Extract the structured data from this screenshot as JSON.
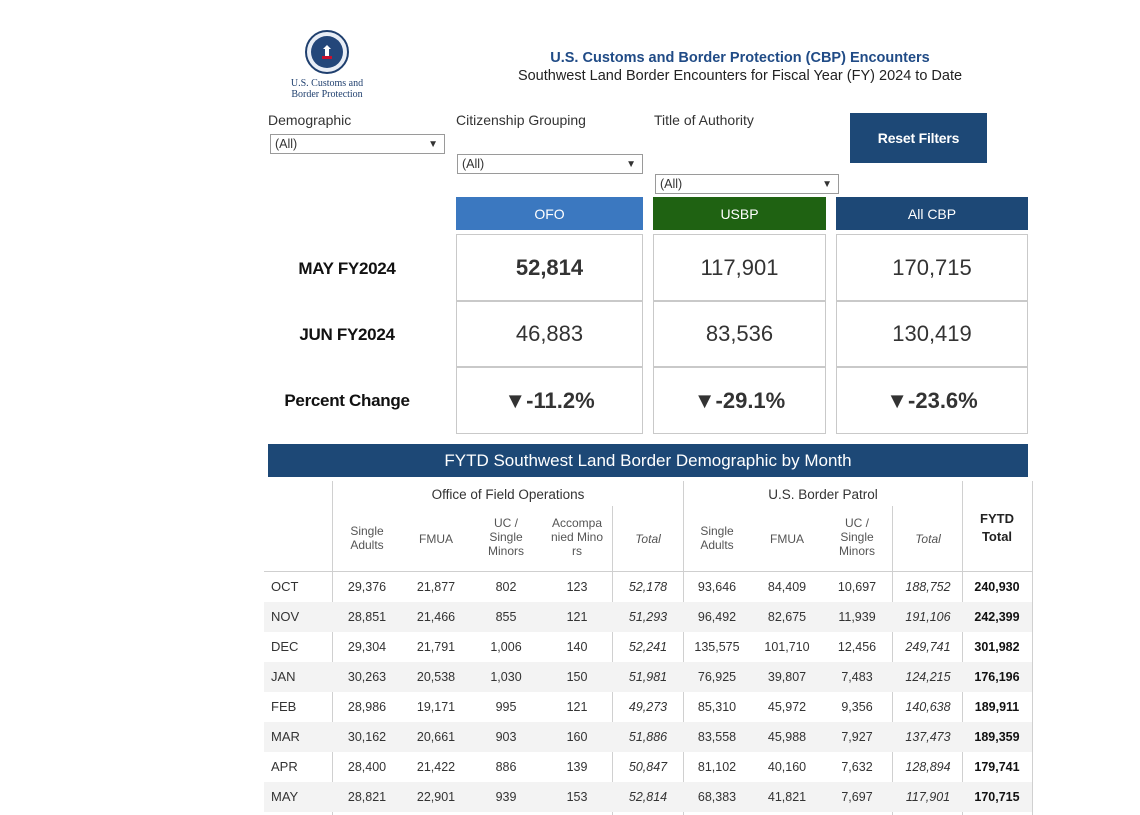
{
  "header": {
    "org_name": "U.S. Customs and Border Protection",
    "title": "U.S. Customs and Border Protection (CBP) Encounters",
    "subtitle": "Southwest Land Border Encounters for Fiscal Year (FY) 2024 to Date"
  },
  "filters": {
    "demographic": {
      "label": "Demographic",
      "value": "(All)"
    },
    "citizenship": {
      "label": "Citizenship Grouping",
      "value": "(All)"
    },
    "authority": {
      "label": "Title of Authority",
      "value": "(All)"
    },
    "reset_label": "Reset Filters"
  },
  "summary": {
    "columns": [
      {
        "label": "OFO",
        "color": "#3b78c0"
      },
      {
        "label": "USBP",
        "color": "#1f6212"
      },
      {
        "label": "All CBP",
        "color": "#1d4876"
      }
    ],
    "rows": [
      {
        "label": "MAY FY2024",
        "values": [
          "52,814",
          "117,901",
          "170,715"
        ]
      },
      {
        "label": "JUN FY2024",
        "values": [
          "46,883",
          "83,536",
          "130,419"
        ]
      },
      {
        "label": "Percent Change",
        "values": [
          "▼-11.2%",
          "▼-29.1%",
          "▼-23.6%"
        ]
      }
    ]
  },
  "table": {
    "banner": "FYTD Southwest Land Border Demographic by Month",
    "ofo_group": "Office of Field Operations",
    "usbp_group": "U.S. Border Patrol",
    "fytd_header": "FYTD Total",
    "headers": [
      "Single Adults",
      "FMUA",
      "UC / Single Minors",
      "Accompanied Minors",
      "Total",
      "Single Adults",
      "FMUA",
      "UC / Single Minors",
      "Total"
    ],
    "header_lines": {
      "single_adults": [
        "Single",
        "Adults"
      ],
      "uc": [
        "UC /",
        "Single",
        "Minors"
      ],
      "accomp": [
        "Accompa",
        "nied Mino",
        "rs"
      ],
      "fytd": [
        "FYTD",
        "Total"
      ]
    },
    "rows": [
      {
        "month": "OCT",
        "cells": [
          "29,376",
          "21,877",
          "802",
          "123",
          "52,178",
          "93,646",
          "84,409",
          "10,697",
          "188,752",
          "240,930"
        ]
      },
      {
        "month": "NOV",
        "cells": [
          "28,851",
          "21,466",
          "855",
          "121",
          "51,293",
          "96,492",
          "82,675",
          "11,939",
          "191,106",
          "242,399"
        ]
      },
      {
        "month": "DEC",
        "cells": [
          "29,304",
          "21,791",
          "1,006",
          "140",
          "52,241",
          "135,575",
          "101,710",
          "12,456",
          "249,741",
          "301,982"
        ]
      },
      {
        "month": "JAN",
        "cells": [
          "30,263",
          "20,538",
          "1,030",
          "150",
          "51,981",
          "76,925",
          "39,807",
          "7,483",
          "124,215",
          "176,196"
        ]
      },
      {
        "month": "FEB",
        "cells": [
          "28,986",
          "19,171",
          "995",
          "121",
          "49,273",
          "85,310",
          "45,972",
          "9,356",
          "140,638",
          "189,911"
        ]
      },
      {
        "month": "MAR",
        "cells": [
          "30,162",
          "20,661",
          "903",
          "160",
          "51,886",
          "83,558",
          "45,988",
          "7,927",
          "137,473",
          "189,359"
        ]
      },
      {
        "month": "APR",
        "cells": [
          "28,400",
          "21,422",
          "886",
          "139",
          "50,847",
          "81,102",
          "40,160",
          "7,632",
          "128,894",
          "179,741"
        ]
      },
      {
        "month": "MAY",
        "cells": [
          "28,821",
          "22,901",
          "939",
          "153",
          "52,814",
          "68,383",
          "41,821",
          "7,697",
          "117,901",
          "170,715"
        ]
      }
    ]
  }
}
